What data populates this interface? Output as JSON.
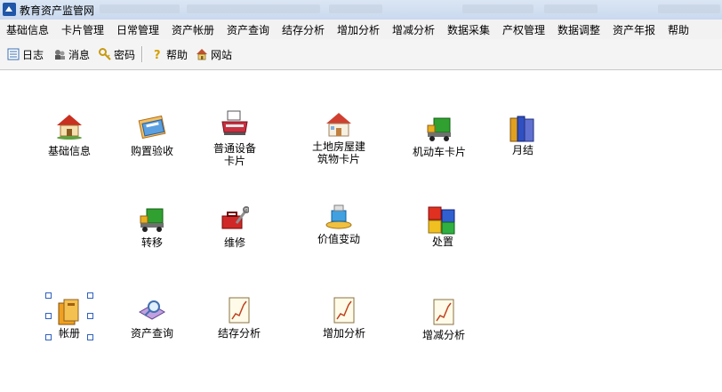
{
  "window": {
    "title": "教育资产监管网"
  },
  "menu": [
    "基础信息",
    "卡片管理",
    "日常管理",
    "资产帐册",
    "资产查询",
    "结存分析",
    "增加分析",
    "增减分析",
    "数据采集",
    "产权管理",
    "数据调整",
    "资产年报",
    "帮助"
  ],
  "toolbar": {
    "log": "日志",
    "message": "消息",
    "password": "密码",
    "help": "帮助",
    "website": "网站"
  },
  "tiles": {
    "basic_info": "基础信息",
    "purchase": "购置验收",
    "equipment_card": "普通设备\n卡片",
    "land_card": "土地房屋建\n筑物卡片",
    "vehicle_card": "机动车卡片",
    "monthly": "月结",
    "transfer": "转移",
    "repair": "维修",
    "value_change": "价值变动",
    "disposal": "处置",
    "ledger": "帐册",
    "asset_query": "资产查询",
    "balance_analysis": "结存分析",
    "increase_analysis": "增加分析",
    "change_analysis": "增减分析"
  }
}
